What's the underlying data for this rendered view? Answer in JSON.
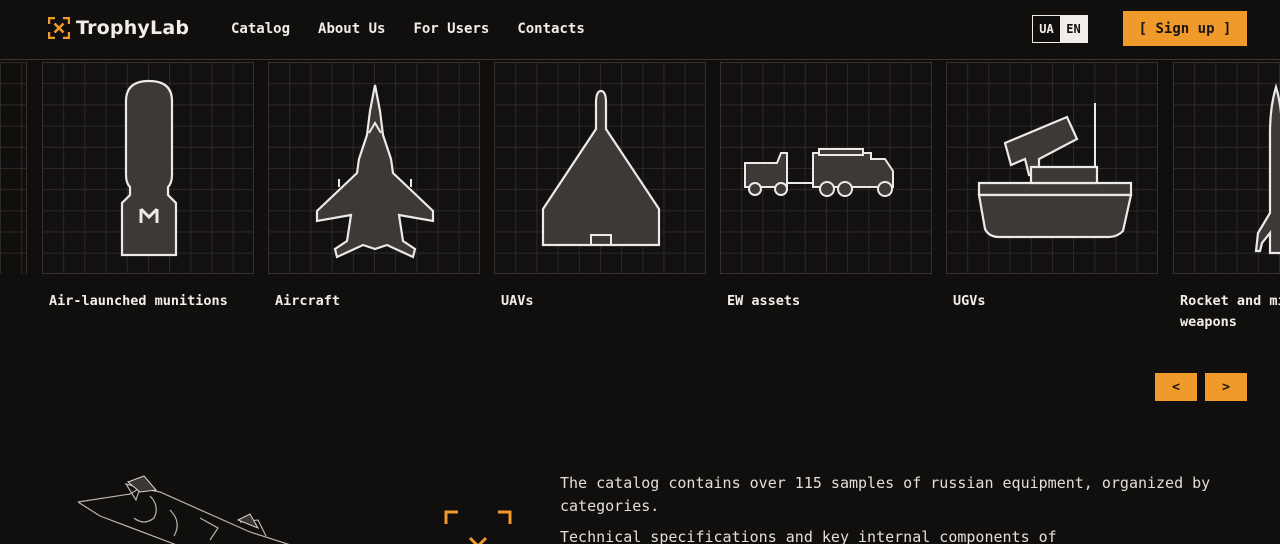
{
  "header": {
    "brand": "TrophyLab",
    "nav": [
      "Catalog",
      "About Us",
      "For Users",
      "Contacts"
    ],
    "lang": {
      "ua": "UA",
      "en": "EN",
      "active": "EN"
    },
    "signup_label": "[ Sign up ]"
  },
  "carousel": {
    "items": [
      {
        "label": "Air-launched munitions",
        "icon": "bomb-icon"
      },
      {
        "label": "Aircraft",
        "icon": "fighter-jet-icon"
      },
      {
        "label": "UAVs",
        "icon": "delta-drone-icon"
      },
      {
        "label": "EW assets",
        "icon": "ew-truck-icon"
      },
      {
        "label": "UGVs",
        "icon": "tracked-vehicle-icon"
      },
      {
        "label": "Rocket and missile weapons",
        "icon": "missile-icon"
      }
    ],
    "prev_label": "<",
    "next_label": ">"
  },
  "about": {
    "p1": "The catalog contains over 115 samples of russian equipment, organized by categories.",
    "p2": "Technical specifications and key internal components of"
  },
  "colors": {
    "accent": "#ef9a2b",
    "background": "#110f0e",
    "text": "#f1eeea"
  }
}
